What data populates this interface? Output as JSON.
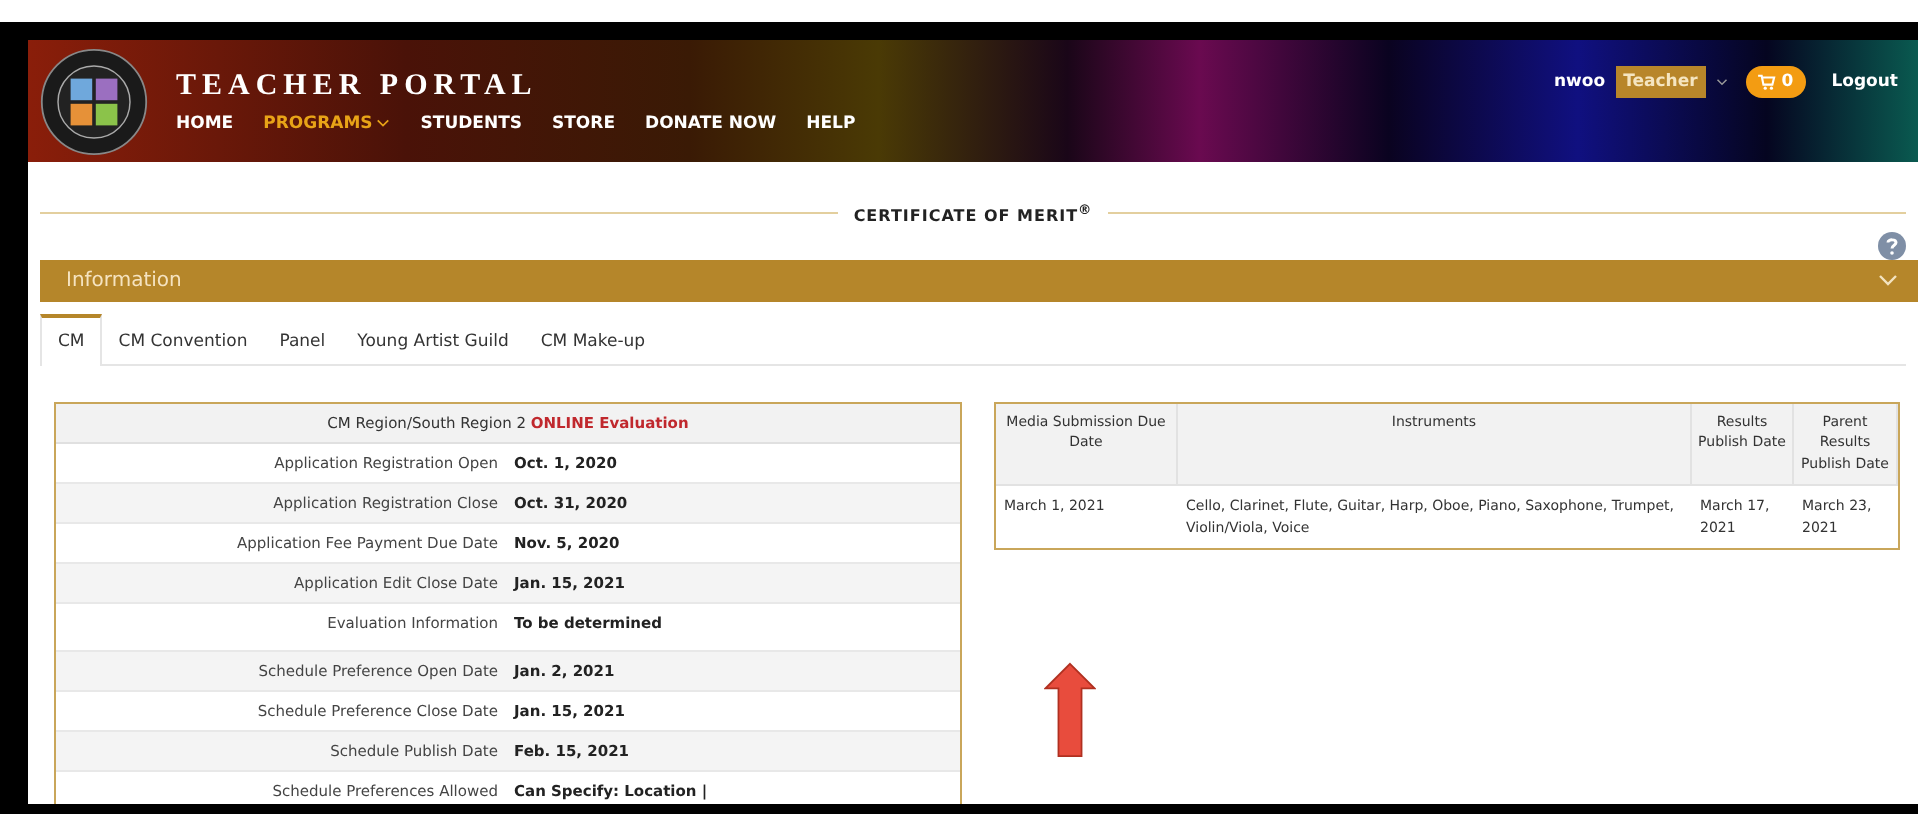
{
  "header": {
    "title": "TEACHER PORTAL",
    "nav": [
      {
        "label": "HOME",
        "selected": false,
        "dropdown": false
      },
      {
        "label": "PROGRAMS",
        "selected": true,
        "dropdown": true
      },
      {
        "label": "STUDENTS",
        "selected": false,
        "dropdown": false
      },
      {
        "label": "STORE",
        "selected": false,
        "dropdown": false
      },
      {
        "label": "DONATE NOW",
        "selected": false,
        "dropdown": false
      },
      {
        "label": "HELP",
        "selected": false,
        "dropdown": false
      }
    ],
    "user": {
      "name": "nwoo",
      "role": "Teacher",
      "cart_count": "0",
      "logout": "Logout"
    }
  },
  "page_title": "CERTIFICATE OF MERIT$^{®}$",
  "panel": {
    "title": "Information",
    "expanded": true
  },
  "tabs": [
    {
      "label": "CM",
      "selected": true
    },
    {
      "label": "CM Convention",
      "selected": false
    },
    {
      "label": "Panel",
      "selected": false
    },
    {
      "label": "Young Artist Guild",
      "selected": false
    },
    {
      "label": "CM Make-up",
      "selected": false
    }
  ],
  "region_table": {
    "heading": "CM Region/South Region 2",
    "heading_highlight": "ONLINE Evaluation",
    "rows": [
      {
        "label": "Application Registration Open",
        "value": "Oct. 1, 2020"
      },
      {
        "label": "Application Registration Close",
        "value": "Oct. 31, 2020"
      },
      {
        "label": "Application Fee Payment Due Date",
        "value": "Nov. 5, 2020"
      },
      {
        "label": "Application Edit Close Date",
        "value": "Jan. 15, 2021"
      },
      {
        "label": "Evaluation Information",
        "value": "To be determined"
      },
      {
        "label": "Schedule Preference Open Date",
        "value": "Jan. 2, 2021"
      },
      {
        "label": "Schedule Preference Close Date",
        "value": "Jan. 15, 2021"
      },
      {
        "label": "Schedule Publish Date",
        "value": "Feb. 15, 2021"
      },
      {
        "label": "Schedule Preferences Allowed",
        "value": "Can Specify: Location |"
      }
    ]
  },
  "dates_table": {
    "columns": [
      "Media Submission Due Date",
      "Instruments",
      "Results Publish Date",
      "Parent Results Publish Date"
    ],
    "rows": [
      [
        "March 1, 2021",
        "Cello, Clarinet, Flute, Guitar, Harp, Oboe, Piano, Saxophone, Trumpet, Violin/Viola, Voice",
        "March 17, 2021",
        "March 23, 2021"
      ]
    ]
  }
}
